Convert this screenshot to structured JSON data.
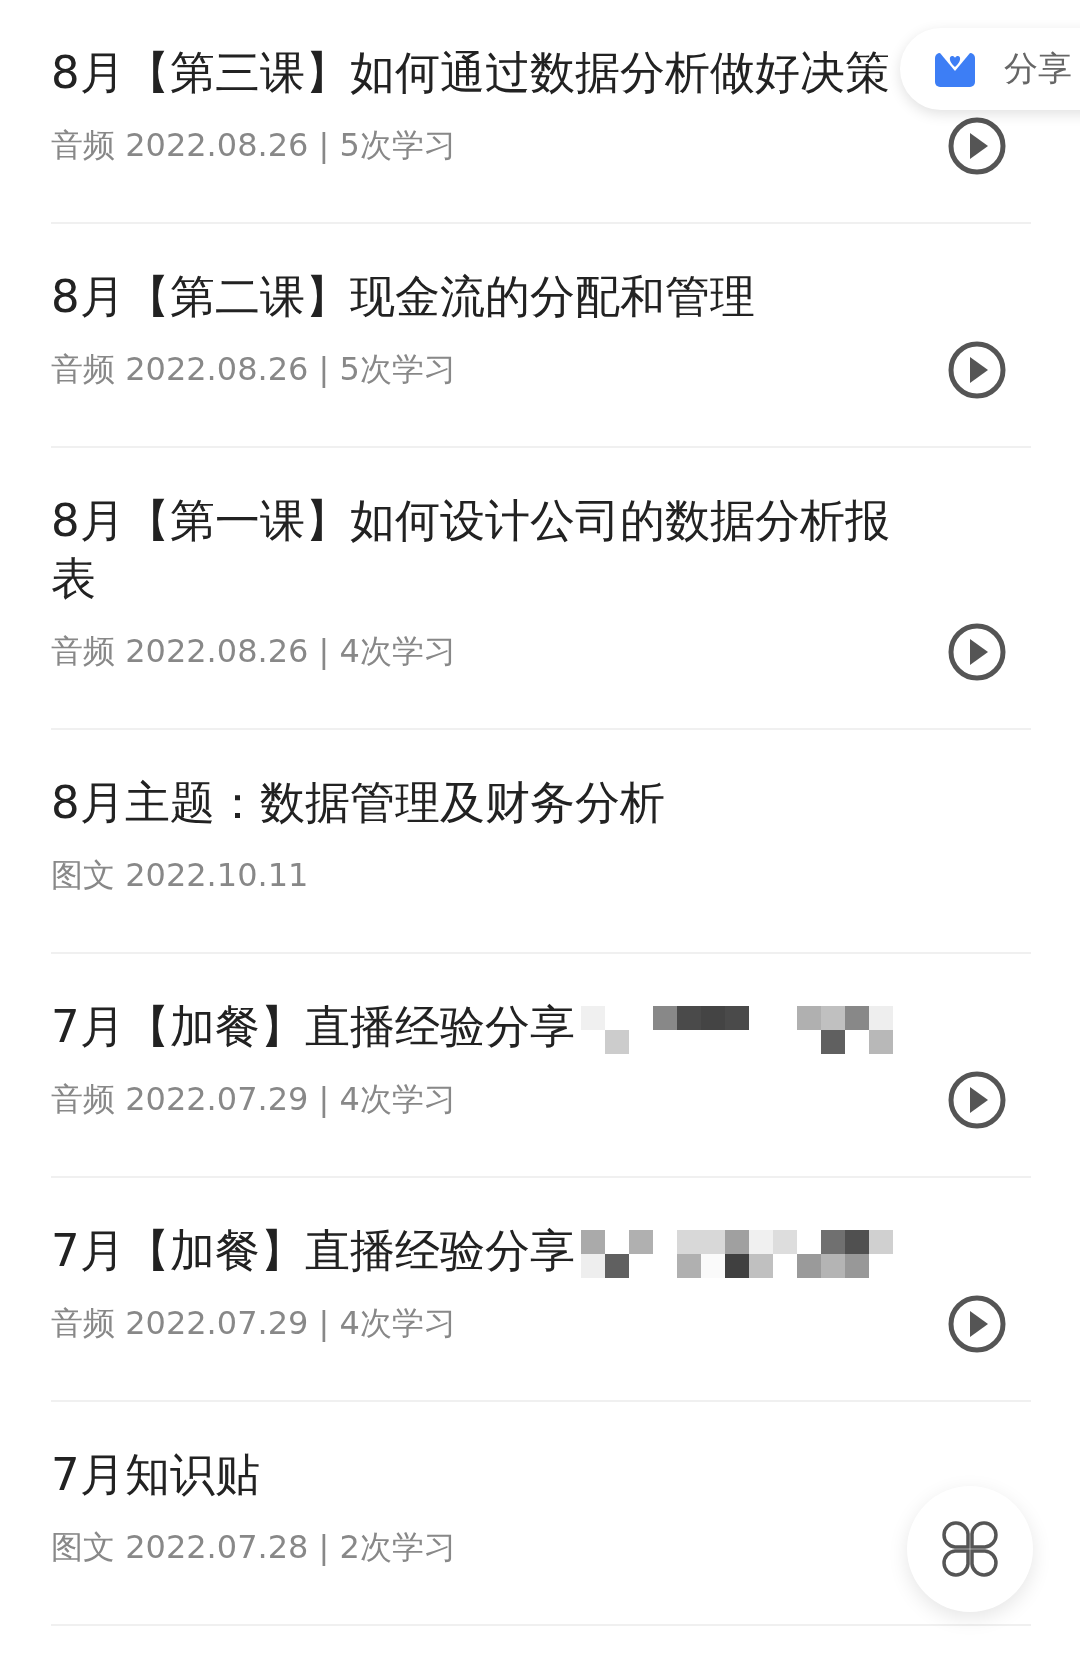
{
  "items": [
    {
      "title": "8月【第三课】如何通过数据分析做好决策",
      "meta": "音频 2022.08.26 | 5次学习",
      "kind": "audio",
      "mosaic": false
    },
    {
      "title": "8月【第二课】现金流的分配和管理",
      "meta": "音频 2022.08.26 | 5次学习",
      "kind": "audio",
      "mosaic": false
    },
    {
      "title": "8月【第一课】如何设计公司的数据分析报表",
      "meta": "音频 2022.08.26 | 4次学习",
      "kind": "audio",
      "mosaic": false
    },
    {
      "title": "8月主题：数据管理及财务分析",
      "meta": "图文 2022.10.11",
      "kind": "article",
      "mosaic": false
    },
    {
      "title": "7月【加餐】直播经验分享",
      "meta": "音频 2022.07.29 | 4次学习",
      "kind": "audio",
      "mosaic": true
    },
    {
      "title": "7月【加餐】直播经验分享",
      "meta": "音频 2022.07.29 | 4次学习",
      "kind": "audio",
      "mosaic": true
    },
    {
      "title": "7月知识贴",
      "meta": "图文 2022.07.28 | 2次学习",
      "kind": "article",
      "mosaic": false
    }
  ],
  "share_button": {
    "label": "分享"
  }
}
